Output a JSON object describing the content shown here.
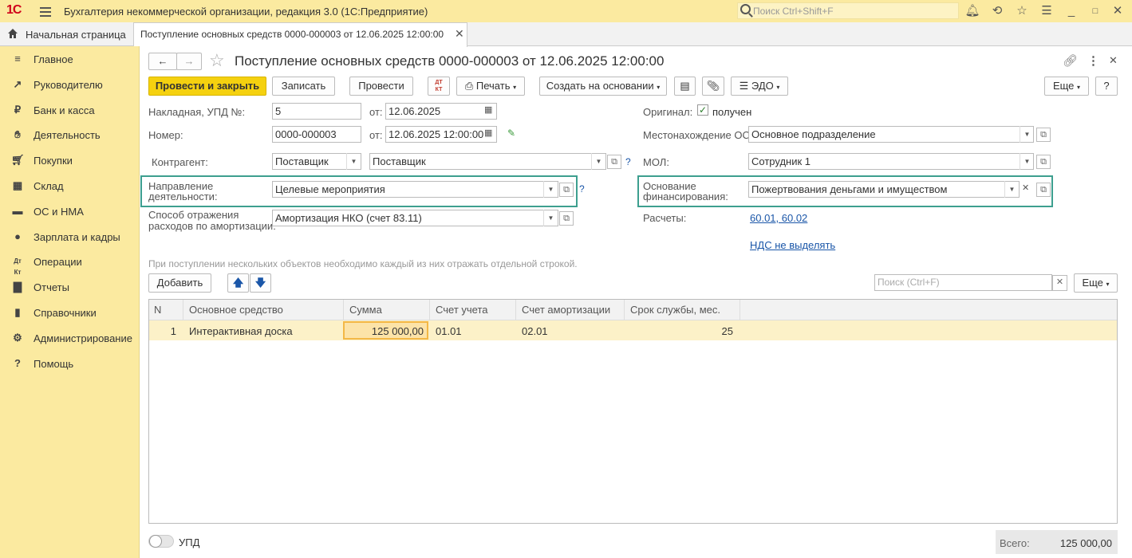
{
  "app": {
    "logo": "1С",
    "title": "Бухгалтерия некоммерческой организации, редакция 3.0  (1С:Предприятие)",
    "search_placeholder": "Поиск Ctrl+Shift+F"
  },
  "tabs": {
    "home": "Начальная страница",
    "doc": "Поступление основных средств 0000-000003 от 12.06.2025 12:00:00"
  },
  "sidebar": {
    "items": [
      {
        "label": "Главное",
        "icon": "menu-icon"
      },
      {
        "label": "Руководителю",
        "icon": "trend-icon"
      },
      {
        "label": "Банк и касса",
        "icon": "ruble-icon"
      },
      {
        "label": "Деятельность",
        "icon": "hands-icon"
      },
      {
        "label": "Покупки",
        "icon": "cart-icon"
      },
      {
        "label": "Склад",
        "icon": "warehouse-icon"
      },
      {
        "label": "ОС и НМА",
        "icon": "truck-icon"
      },
      {
        "label": "Зарплата и кадры",
        "icon": "person-icon"
      },
      {
        "label": "Операции",
        "icon": "dt-kt-icon"
      },
      {
        "label": "Отчеты",
        "icon": "bar-chart-icon"
      },
      {
        "label": "Справочники",
        "icon": "book-icon"
      },
      {
        "label": "Администрирование",
        "icon": "gear-icon"
      },
      {
        "label": "Помощь",
        "icon": "help-icon"
      }
    ]
  },
  "document": {
    "title": "Поступление основных средств 0000-000003 от 12.06.2025 12:00:00",
    "toolbar": {
      "post_close": "Провести и закрыть",
      "save": "Записать",
      "post": "Провести",
      "print": "Печать",
      "create_based": "Создать на основании",
      "edo": "ЭДО",
      "more": "Еще",
      "help": "?"
    },
    "fields": {
      "invoice_label": "Накладная, УПД №:",
      "invoice_no": "5",
      "from_label": "от:",
      "invoice_date": "12.06.2025",
      "number_label": "Номер:",
      "number": "0000-000003",
      "number_date": "12.06.2025 12:00:00",
      "contractor_label": "Контрагент:",
      "contractor_type": "Поставщик",
      "contractor": "Поставщик",
      "activity_label_1": "Направление",
      "activity_label_2": "деятельности:",
      "activity": "Целевые мероприятия",
      "amort_label_1": "Способ отражения",
      "amort_label_2": "расходов по амортизации:",
      "amort": "Амортизация НКО (счет 83.11)",
      "original_label": "Оригинал:",
      "original_value": "получен",
      "location_label": "Местонахождение ОС:",
      "location": "Основное подразделение",
      "mol_label": "МОЛ:",
      "mol": "Сотрудник 1",
      "funding_label_1": "Основание",
      "funding_label_2": "финансирования:",
      "funding": "Пожертвования деньгами и имуществом",
      "settlements_label": "Расчеты:",
      "settlements": "60.01, 60.02",
      "vat": "НДС не выделять",
      "hint": "При поступлении нескольких объектов необходимо каждый из них отражать отдельной строкой."
    },
    "table_toolbar": {
      "add": "Добавить",
      "search_placeholder": "Поиск (Ctrl+F)",
      "more": "Еще"
    },
    "table": {
      "columns": [
        "N",
        "Основное средство",
        "Сумма",
        "Счет учета",
        "Счет амортизации",
        "Срок службы, мес."
      ],
      "rows": [
        {
          "n": "1",
          "asset": "Интерактивная доска",
          "sum": "125 000,00",
          "account": "01.01",
          "amort_account": "02.01",
          "life": "25"
        }
      ]
    },
    "footer": {
      "upd": "УПД",
      "total_label": "Всего:",
      "total": "125 000,00"
    }
  },
  "colors": {
    "accent": "#f5d10f",
    "sidebar": "#fbeaa0",
    "highlight": "#3d9f8f"
  }
}
